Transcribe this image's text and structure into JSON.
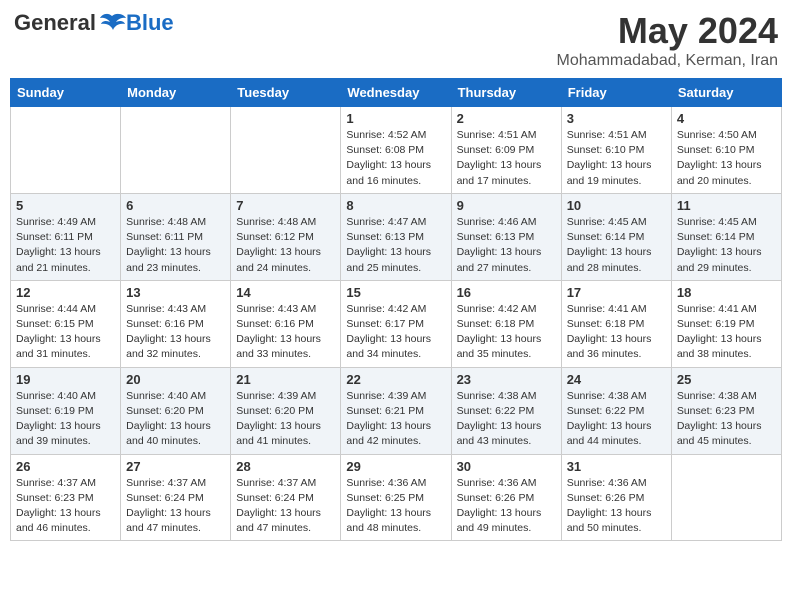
{
  "header": {
    "logo_general": "General",
    "logo_blue": "Blue",
    "month_year": "May 2024",
    "location": "Mohammadabad, Kerman, Iran"
  },
  "weekdays": [
    "Sunday",
    "Monday",
    "Tuesday",
    "Wednesday",
    "Thursday",
    "Friday",
    "Saturday"
  ],
  "weeks": [
    [
      {
        "day": "",
        "info": ""
      },
      {
        "day": "",
        "info": ""
      },
      {
        "day": "",
        "info": ""
      },
      {
        "day": "1",
        "info": "Sunrise: 4:52 AM\nSunset: 6:08 PM\nDaylight: 13 hours and 16 minutes."
      },
      {
        "day": "2",
        "info": "Sunrise: 4:51 AM\nSunset: 6:09 PM\nDaylight: 13 hours and 17 minutes."
      },
      {
        "day": "3",
        "info": "Sunrise: 4:51 AM\nSunset: 6:10 PM\nDaylight: 13 hours and 19 minutes."
      },
      {
        "day": "4",
        "info": "Sunrise: 4:50 AM\nSunset: 6:10 PM\nDaylight: 13 hours and 20 minutes."
      }
    ],
    [
      {
        "day": "5",
        "info": "Sunrise: 4:49 AM\nSunset: 6:11 PM\nDaylight: 13 hours and 21 minutes."
      },
      {
        "day": "6",
        "info": "Sunrise: 4:48 AM\nSunset: 6:11 PM\nDaylight: 13 hours and 23 minutes."
      },
      {
        "day": "7",
        "info": "Sunrise: 4:48 AM\nSunset: 6:12 PM\nDaylight: 13 hours and 24 minutes."
      },
      {
        "day": "8",
        "info": "Sunrise: 4:47 AM\nSunset: 6:13 PM\nDaylight: 13 hours and 25 minutes."
      },
      {
        "day": "9",
        "info": "Sunrise: 4:46 AM\nSunset: 6:13 PM\nDaylight: 13 hours and 27 minutes."
      },
      {
        "day": "10",
        "info": "Sunrise: 4:45 AM\nSunset: 6:14 PM\nDaylight: 13 hours and 28 minutes."
      },
      {
        "day": "11",
        "info": "Sunrise: 4:45 AM\nSunset: 6:14 PM\nDaylight: 13 hours and 29 minutes."
      }
    ],
    [
      {
        "day": "12",
        "info": "Sunrise: 4:44 AM\nSunset: 6:15 PM\nDaylight: 13 hours and 31 minutes."
      },
      {
        "day": "13",
        "info": "Sunrise: 4:43 AM\nSunset: 6:16 PM\nDaylight: 13 hours and 32 minutes."
      },
      {
        "day": "14",
        "info": "Sunrise: 4:43 AM\nSunset: 6:16 PM\nDaylight: 13 hours and 33 minutes."
      },
      {
        "day": "15",
        "info": "Sunrise: 4:42 AM\nSunset: 6:17 PM\nDaylight: 13 hours and 34 minutes."
      },
      {
        "day": "16",
        "info": "Sunrise: 4:42 AM\nSunset: 6:18 PM\nDaylight: 13 hours and 35 minutes."
      },
      {
        "day": "17",
        "info": "Sunrise: 4:41 AM\nSunset: 6:18 PM\nDaylight: 13 hours and 36 minutes."
      },
      {
        "day": "18",
        "info": "Sunrise: 4:41 AM\nSunset: 6:19 PM\nDaylight: 13 hours and 38 minutes."
      }
    ],
    [
      {
        "day": "19",
        "info": "Sunrise: 4:40 AM\nSunset: 6:19 PM\nDaylight: 13 hours and 39 minutes."
      },
      {
        "day": "20",
        "info": "Sunrise: 4:40 AM\nSunset: 6:20 PM\nDaylight: 13 hours and 40 minutes."
      },
      {
        "day": "21",
        "info": "Sunrise: 4:39 AM\nSunset: 6:20 PM\nDaylight: 13 hours and 41 minutes."
      },
      {
        "day": "22",
        "info": "Sunrise: 4:39 AM\nSunset: 6:21 PM\nDaylight: 13 hours and 42 minutes."
      },
      {
        "day": "23",
        "info": "Sunrise: 4:38 AM\nSunset: 6:22 PM\nDaylight: 13 hours and 43 minutes."
      },
      {
        "day": "24",
        "info": "Sunrise: 4:38 AM\nSunset: 6:22 PM\nDaylight: 13 hours and 44 minutes."
      },
      {
        "day": "25",
        "info": "Sunrise: 4:38 AM\nSunset: 6:23 PM\nDaylight: 13 hours and 45 minutes."
      }
    ],
    [
      {
        "day": "26",
        "info": "Sunrise: 4:37 AM\nSunset: 6:23 PM\nDaylight: 13 hours and 46 minutes."
      },
      {
        "day": "27",
        "info": "Sunrise: 4:37 AM\nSunset: 6:24 PM\nDaylight: 13 hours and 47 minutes."
      },
      {
        "day": "28",
        "info": "Sunrise: 4:37 AM\nSunset: 6:24 PM\nDaylight: 13 hours and 47 minutes."
      },
      {
        "day": "29",
        "info": "Sunrise: 4:36 AM\nSunset: 6:25 PM\nDaylight: 13 hours and 48 minutes."
      },
      {
        "day": "30",
        "info": "Sunrise: 4:36 AM\nSunset: 6:26 PM\nDaylight: 13 hours and 49 minutes."
      },
      {
        "day": "31",
        "info": "Sunrise: 4:36 AM\nSunset: 6:26 PM\nDaylight: 13 hours and 50 minutes."
      },
      {
        "day": "",
        "info": ""
      }
    ]
  ]
}
